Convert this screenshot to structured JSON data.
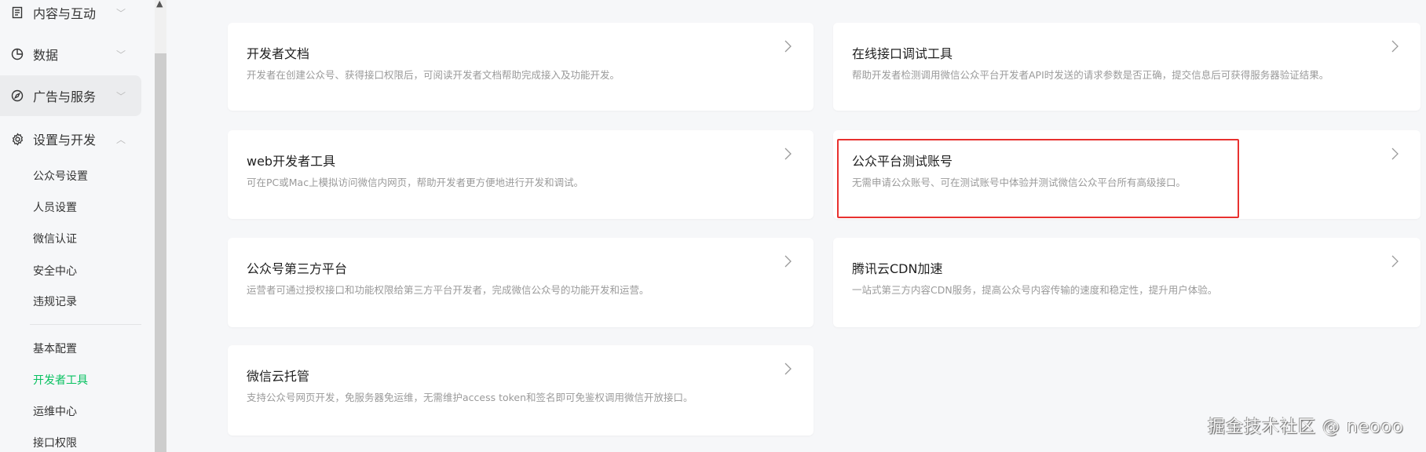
{
  "sidebar": {
    "nav": [
      {
        "label": "内容与互动",
        "icon": "document-icon",
        "expanded": false
      },
      {
        "label": "数据",
        "icon": "pie-chart-icon",
        "expanded": false
      },
      {
        "label": "广告与服务",
        "icon": "compass-icon",
        "expanded": false
      },
      {
        "label": "设置与开发",
        "icon": "gear-icon",
        "expanded": true
      }
    ],
    "sub_items": [
      "公众号设置",
      "人员设置",
      "微信认证",
      "安全中心",
      "违规记录"
    ],
    "sub_items2": [
      "基本配置",
      "开发者工具",
      "运维中心",
      "接口权限"
    ],
    "active": "开发者工具"
  },
  "cards": [
    {
      "title": "开发者文档",
      "desc": "开发者在创建公众号、获得接口权限后，可阅读开发者文档帮助完成接入及功能开发。"
    },
    {
      "title": "在线接口调试工具",
      "desc": "帮助开发者检测调用微信公众平台开发者API时发送的请求参数是否正确，提交信息后可获得服务器验证结果。"
    },
    {
      "title": "web开发者工具",
      "desc": "可在PC或Mac上模拟访问微信内网页，帮助开发者更方便地进行开发和调试。"
    },
    {
      "title": "公众平台测试账号",
      "desc": "无需申请公众账号、可在测试账号中体验并测试微信公众平台所有高级接口。"
    },
    {
      "title": "公众号第三方平台",
      "desc": "运营者可通过授权接口和功能权限给第三方平台开发者，完成微信公众号的功能开发和运营。"
    },
    {
      "title": "腾讯云CDN加速",
      "desc": "一站式第三方内容CDN服务，提高公众号内容传输的速度和稳定性，提升用户体验。"
    },
    {
      "title": "微信云托管",
      "desc": "支持公众号网页开发，免服务器免运维，无需维护access token和签名即可免鉴权调用微信开放接口。"
    }
  ],
  "watermark": "掘金技术社区 @ neooo",
  "colors": {
    "accent": "#07c160",
    "highlight_box": "#e8312f"
  }
}
